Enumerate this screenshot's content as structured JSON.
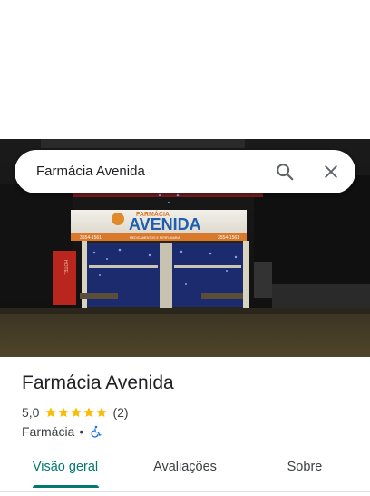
{
  "search": {
    "query": "Farmácia Avenida"
  },
  "photo": {
    "sign_top_text": "FARMÁCIA",
    "sign_main_text": "AVENIDA",
    "sign_sub_text": "MEDICAMENTOS E PERFUMARIA",
    "sign_phone_left": "3554-1561",
    "sign_phone_right": "3554-1561",
    "side_sign_text": "HOTEL"
  },
  "place": {
    "title": "Farmácia Avenida",
    "rating_value": "5,0",
    "rating": 5,
    "max_rating": 5,
    "review_count": "(2)",
    "category": "Farmácia",
    "separator": "•"
  },
  "tabs": [
    {
      "label": "Visão geral",
      "active": true
    },
    {
      "label": "Avaliações",
      "active": false
    },
    {
      "label": "Sobre",
      "active": false
    }
  ],
  "colors": {
    "accent": "#01796f",
    "star": "#fbbc04",
    "accessibility_icon": "#1a73e8"
  },
  "icons": {
    "search": "search-icon",
    "close": "close-icon",
    "accessibility": "wheelchair-icon"
  }
}
